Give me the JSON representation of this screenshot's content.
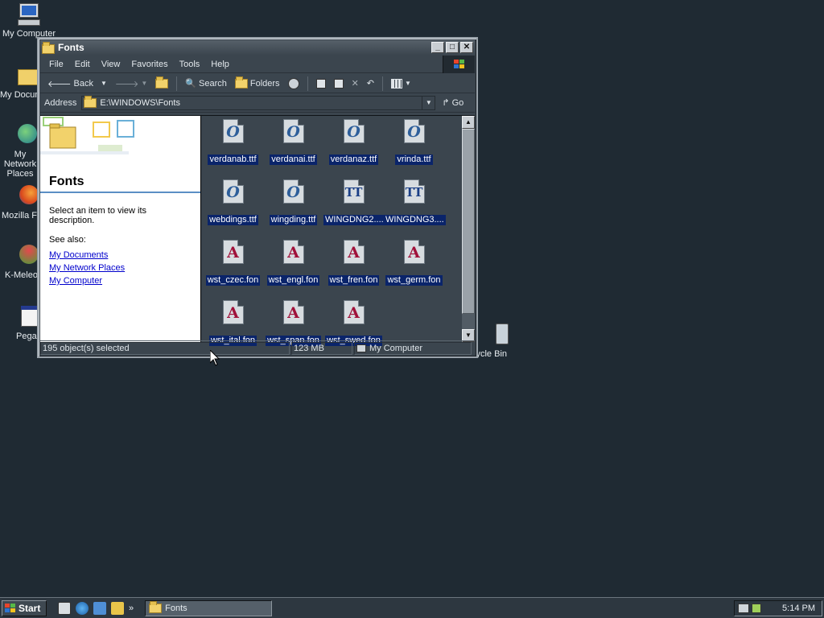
{
  "desktop": {
    "icons": [
      {
        "label": "My Computer"
      },
      {
        "label": "My Documents"
      },
      {
        "label": "My Network Places"
      },
      {
        "label": "Mozilla Firefox"
      },
      {
        "label": "K-Meleon"
      },
      {
        "label": "Pegasus"
      },
      {
        "label": "Recycle Bin"
      }
    ]
  },
  "window": {
    "title": "Fonts",
    "buttons": {
      "minimize": "_",
      "maximize": "□",
      "close": "✕"
    },
    "menu": [
      "File",
      "Edit",
      "View",
      "Favorites",
      "Tools",
      "Help"
    ],
    "toolbar": {
      "back_label": "Back",
      "search_label": "Search",
      "folders_label": "Folders"
    },
    "address": {
      "label": "Address",
      "value": "E:\\WINDOWS\\Fonts",
      "go_label": "Go"
    },
    "left_pane": {
      "title": "Fonts",
      "description": "Select an item to view its description.",
      "see_also": "See also:",
      "links": [
        "My Documents",
        "My Network Places",
        "My Computer"
      ]
    },
    "files": [
      {
        "name": "verdanab.ttf",
        "type": "opentype"
      },
      {
        "name": "verdanai.ttf",
        "type": "opentype"
      },
      {
        "name": "verdanaz.ttf",
        "type": "opentype"
      },
      {
        "name": "vrinda.ttf",
        "type": "opentype"
      },
      {
        "name": "webdings.ttf",
        "type": "opentype"
      },
      {
        "name": "wingding.ttf",
        "type": "opentype"
      },
      {
        "name": "WINGDNG2....",
        "type": "truetype"
      },
      {
        "name": "WINGDNG3....",
        "type": "truetype"
      },
      {
        "name": "wst_czec.fon",
        "type": "raster"
      },
      {
        "name": "wst_engl.fon",
        "type": "raster"
      },
      {
        "name": "wst_fren.fon",
        "type": "raster"
      },
      {
        "name": "wst_germ.fon",
        "type": "raster"
      },
      {
        "name": "wst_ital.fon",
        "type": "raster"
      },
      {
        "name": "wst_span.fon",
        "type": "raster"
      },
      {
        "name": "wst_swed.fon",
        "type": "raster"
      }
    ],
    "status": {
      "selection": "195 object(s) selected",
      "size": "123 MB",
      "zone": "My Computer"
    }
  },
  "taskbar": {
    "start_label": "Start",
    "task_label": "Fonts",
    "clock": "5:14 PM"
  },
  "colors": {
    "selection": "#0a246a",
    "window_bg": "#3b454e",
    "desktop_bg": "#1f2a33"
  }
}
